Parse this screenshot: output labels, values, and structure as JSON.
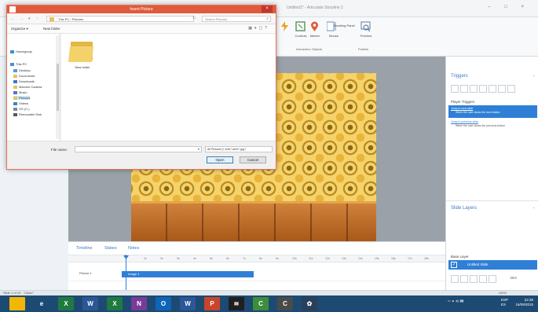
{
  "app": {
    "title": "Untitled1* - Articulate Storyline 2",
    "window_controls": "– □ ×"
  },
  "ribbon": {
    "buttons": [
      {
        "label": "Trigger",
        "icon": "lightning-icon"
      },
      {
        "label": "Hotspot",
        "icon": "hotspot-icon"
      },
      {
        "label": "Marker",
        "icon": "marker-icon"
      },
      {
        "label": "Scrolling Panel",
        "icon": "scrolling-panel-icon"
      },
      {
        "label": "Preview",
        "icon": "preview-icon"
      }
    ],
    "group_interactive": "Interactive Objects",
    "group_publish": "Publish",
    "extra_labels": [
      "Controls",
      "Mouse"
    ]
  },
  "timeline": {
    "tabs": [
      "Timeline",
      "States",
      "Notes"
    ],
    "ruler_ticks": [
      "1s",
      "2s",
      "3s",
      "4s",
      "5s",
      "6s",
      "7s",
      "8s",
      "9s",
      "10s",
      "11s",
      "12s",
      "13s",
      "14s",
      "15s",
      "16s",
      "17s",
      "18s"
    ],
    "row_name": "Picture 1",
    "bar_label": "Image 1"
  },
  "status": {
    "slide": "Slide 1 of 15",
    "theme": "\"Clean\"",
    "zoom": "100%"
  },
  "triggers_panel": {
    "title": "Triggers",
    "player_triggers": "Player Triggers",
    "trigger1_link": "Jump to next slide",
    "trigger1_text": "When the user clicks the next button",
    "trigger2_link": "Jump to previous slide",
    "trigger2_text": "When the user clicks the previous button",
    "slide_layers": "Slide Layers",
    "base_layer_label": "Base Layer",
    "base_layer_name": "Untitled Slide",
    "dim_label": "Dim"
  },
  "dialog": {
    "title": "Insert Picture",
    "breadcrumb": "This PC  ›  Pictures",
    "search_placeholder": "Search Pictures",
    "organize": "Organize ▾",
    "new_folder": "New folder",
    "nav_items": [
      "Homegroup",
      "This PC",
      "Desktop",
      "Documents",
      "Downloads",
      "Marcelo Cadena",
      "Music",
      "Pictures",
      "Videos",
      "OS (C:)",
      "Removable Disk"
    ],
    "folder_name": "New folder",
    "file_name_label": "File name:",
    "file_name_value": "",
    "filter": "All Pictures (*.emf;*.wmf;*.jpg;*",
    "open": "Open",
    "cancel": "Cancel",
    "close": "×"
  },
  "taskbar": {
    "apps": [
      {
        "name": "windows-explorer-icon",
        "color": "#f2b705",
        "glyph": ""
      },
      {
        "name": "internet-explorer-icon",
        "color": "#1d4a72",
        "glyph": "e"
      },
      {
        "name": "excel-icon",
        "color": "#1f7a3f",
        "glyph": "X"
      },
      {
        "name": "word-icon",
        "color": "#2b5797",
        "glyph": "W"
      },
      {
        "name": "excel-icon-2",
        "color": "#1f7a3f",
        "glyph": "X"
      },
      {
        "name": "onenote-icon",
        "color": "#7a3a9a",
        "glyph": "N"
      },
      {
        "name": "outlook-icon",
        "color": "#0f64b7",
        "glyph": "O"
      },
      {
        "name": "word-icon-2",
        "color": "#2b5797",
        "glyph": "W"
      },
      {
        "name": "powerpoint-icon",
        "color": "#c8452b",
        "glyph": "P"
      },
      {
        "name": "spotify-icon",
        "color": "#1f1f1f",
        "glyph": "≋"
      },
      {
        "name": "camtasia-icon",
        "color": "#3c8d3c",
        "glyph": "C"
      },
      {
        "name": "storyline-icon",
        "color": "#4a4a4a",
        "glyph": "C"
      },
      {
        "name": "photoshop-icon",
        "color": "#2a3f5a",
        "glyph": "✿"
      }
    ],
    "lang": "ESP",
    "lang2": "ES",
    "time": "22:36",
    "date": "16/09/2015"
  }
}
